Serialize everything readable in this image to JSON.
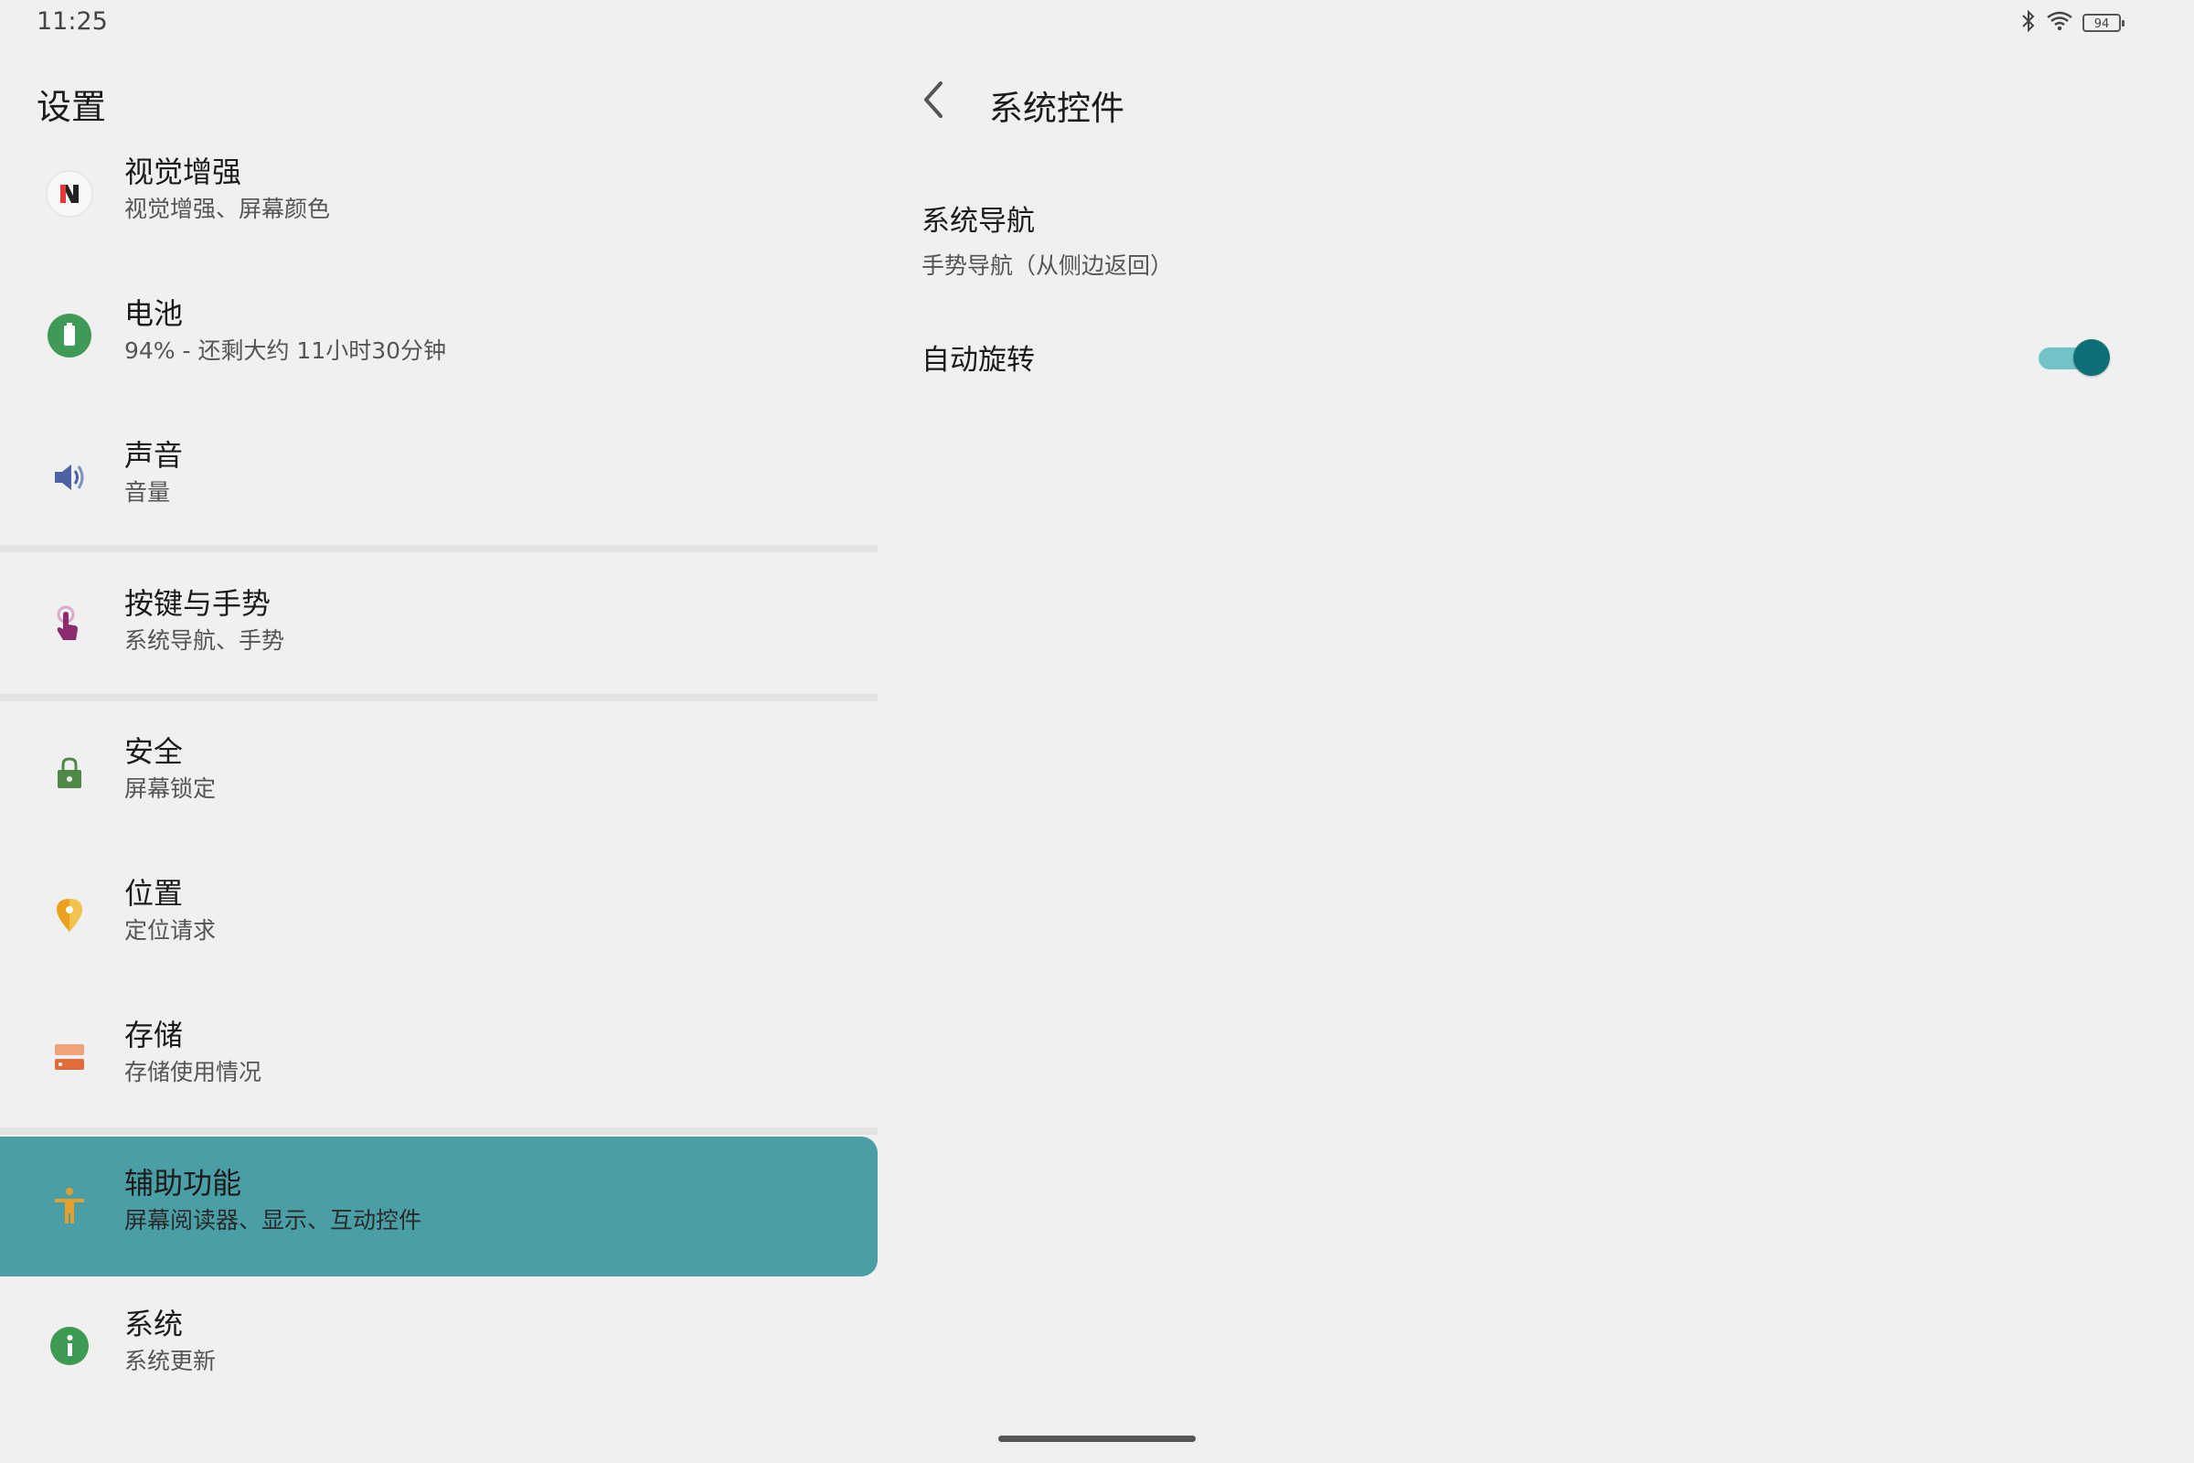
{
  "status_bar": {
    "time": "11:25",
    "battery_level": "94",
    "icons": [
      "bluetooth-icon",
      "wifi-icon",
      "battery-icon"
    ]
  },
  "left_pane": {
    "title": "设置",
    "items": [
      {
        "title": "视觉增强",
        "subtitle": "视觉增强、屏幕颜色",
        "icon": "visual-enhance-icon"
      },
      {
        "title": "电池",
        "subtitle": "94% - 还剩大约 11小时30分钟",
        "icon": "battery-icon"
      },
      {
        "title": "声音",
        "subtitle": "音量",
        "icon": "volume-icon"
      },
      {
        "title": "按键与手势",
        "subtitle": "系统导航、手势",
        "icon": "gesture-icon"
      },
      {
        "title": "安全",
        "subtitle": "屏幕锁定",
        "icon": "lock-icon"
      },
      {
        "title": "位置",
        "subtitle": "定位请求",
        "icon": "location-icon"
      },
      {
        "title": "存储",
        "subtitle": "存储使用情况",
        "icon": "storage-icon"
      },
      {
        "title": "辅助功能",
        "subtitle": "屏幕阅读器、显示、互动控件",
        "icon": "accessibility-icon",
        "selected": true
      },
      {
        "title": "系统",
        "subtitle": "系统更新",
        "icon": "info-icon"
      }
    ]
  },
  "right_pane": {
    "title": "系统控件",
    "items": [
      {
        "title": "系统导航",
        "subtitle": "手势导航（从侧边返回）"
      },
      {
        "title": "自动旋转",
        "toggle_on": true
      }
    ]
  },
  "colors": {
    "background": "#eff0ef",
    "selected": "#4a9ea6",
    "toggle_track": "#72c3c7",
    "toggle_thumb": "#0f6f78"
  }
}
